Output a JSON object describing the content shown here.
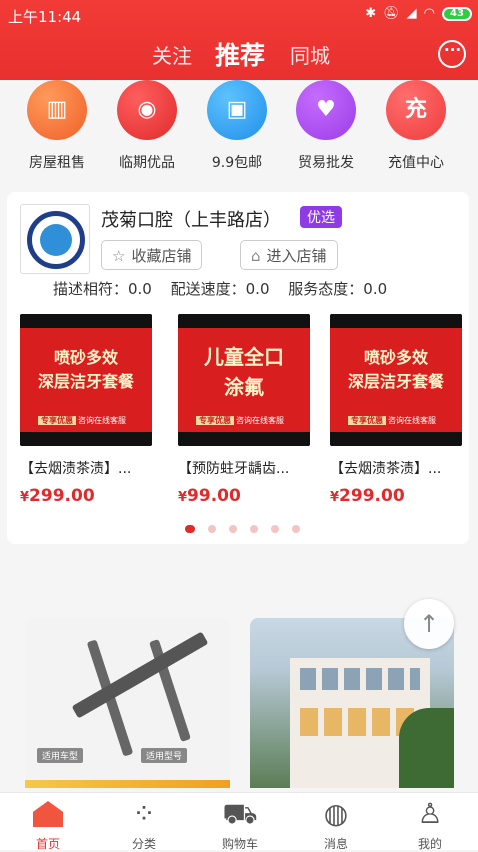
{
  "status_bar": {
    "time": "上午11:44",
    "battery": "43"
  },
  "header": {
    "tabs": [
      "关注",
      "推荐",
      "同城"
    ]
  },
  "categories": [
    {
      "label": "房屋租售",
      "icon": "building-icon"
    },
    {
      "label": "临期优品",
      "icon": "globe-icon"
    },
    {
      "label": "9.9包邮",
      "icon": "package-icon"
    },
    {
      "label": "贸易批发",
      "icon": "handshake-icon"
    },
    {
      "label": "充值中心",
      "icon": "recharge-icon",
      "glyph": "充"
    }
  ],
  "store": {
    "name": "茂菊口腔（上丰路店）",
    "badge": "优选",
    "favorite_label": "收藏店铺",
    "enter_label": "进入店铺",
    "ratings": [
      "描述相符：0.0",
      "配送速度：0.0",
      "服务态度：0.0"
    ],
    "products": [
      {
        "banner": [
          "喷砂多效",
          "深层洁牙套餐"
        ],
        "tag": "专享优惠",
        "tag_note": "咨询在线客服",
        "title": "【去烟渍茶渍】...",
        "currency": "¥",
        "price": "299.00"
      },
      {
        "banner": [
          "儿童全口",
          "涂氟"
        ],
        "tag": "专享优惠",
        "tag_note": "咨询在线客服",
        "title": "【预防蛀牙龋齿...",
        "currency": "¥",
        "price": "99.00"
      },
      {
        "banner": [
          "喷砂多效",
          "深层洁牙套餐"
        ],
        "tag": "专享优惠",
        "tag_note": "咨询在线客服",
        "title": "【去烟渍茶渍】...",
        "currency": "¥",
        "price": "299.00"
      }
    ],
    "carousel_pages": 6,
    "carousel_active": 0
  },
  "feed": {
    "item1": {
      "labels": [
        "适用车型",
        "适用型号"
      ]
    }
  },
  "bottom_nav": [
    {
      "label": "首页",
      "icon": "home-icon",
      "active": true
    },
    {
      "label": "分类",
      "icon": "category-icon"
    },
    {
      "label": "购物车",
      "icon": "cart-icon"
    },
    {
      "label": "消息",
      "icon": "message-icon"
    },
    {
      "label": "我的",
      "icon": "profile-icon"
    }
  ],
  "colors": {
    "brand_red": "#e8302f",
    "price_red": "#e02b2b",
    "badge_purple": "#8e3be6"
  }
}
